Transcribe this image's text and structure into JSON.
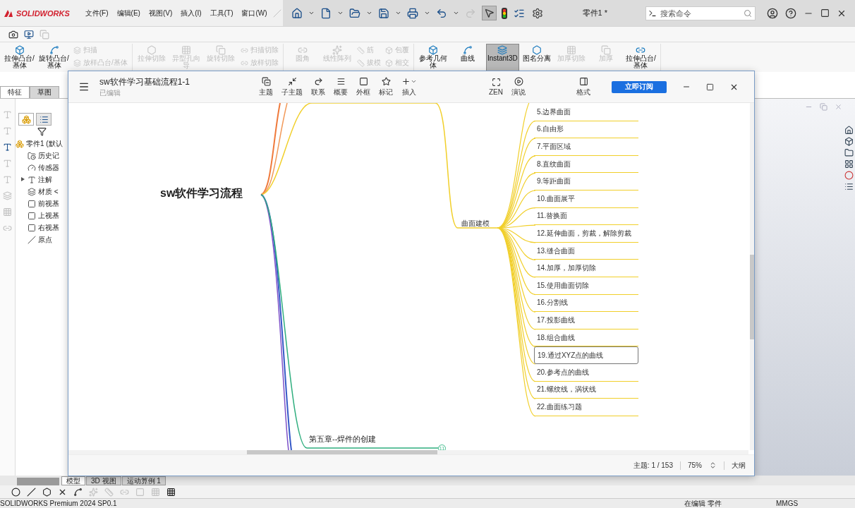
{
  "app": {
    "logo": "SOLIDWORKS",
    "menus": [
      "文件(F)",
      "编辑(E)",
      "视图(V)",
      "插入(I)",
      "工具(T)",
      "窗口(W)"
    ],
    "document_title": "零件1 *",
    "search": {
      "placeholder": "搜索命令"
    }
  },
  "ribbon": [
    {
      "items": [
        {
          "kind": "large",
          "label": "拉伸凸台/基体",
          "disabled": false,
          "on": false
        },
        {
          "kind": "large",
          "label": "旋转凸台/基体",
          "disabled": false,
          "on": false
        },
        {
          "kind": "stack",
          "items": [
            {
              "label": "扫描",
              "disabled": true
            },
            {
              "label": "放样凸台/基体",
              "disabled": true
            }
          ]
        }
      ]
    },
    {
      "items": [
        {
          "kind": "large",
          "label": "拉伸切除",
          "disabled": true,
          "on": false
        },
        {
          "kind": "large",
          "label": "异型孔向导",
          "disabled": true,
          "on": false
        },
        {
          "kind": "large",
          "label": "旋转切除",
          "disabled": true,
          "on": false
        },
        {
          "kind": "stack",
          "items": [
            {
              "label": "扫描切除",
              "disabled": true
            },
            {
              "label": "放样切除",
              "disabled": true
            }
          ]
        }
      ]
    },
    {
      "items": [
        {
          "kind": "large",
          "label": "圆角",
          "disabled": true,
          "on": false
        },
        {
          "kind": "large",
          "label": "线性阵列",
          "disabled": true,
          "on": false
        },
        {
          "kind": "stack",
          "items": [
            {
              "label": "筋",
              "disabled": true
            },
            {
              "label": "拔模",
              "disabled": true
            }
          ]
        },
        {
          "kind": "stack",
          "items": [
            {
              "label": "包覆",
              "disabled": true
            },
            {
              "label": "相交",
              "disabled": true
            }
          ]
        }
      ]
    },
    {
      "items": [
        {
          "kind": "large",
          "label": "参考几何体",
          "disabled": false,
          "on": false
        },
        {
          "kind": "large",
          "label": "曲线",
          "disabled": false,
          "on": false
        },
        {
          "kind": "large",
          "label": "Instant3D",
          "disabled": false,
          "on": true
        },
        {
          "kind": "large",
          "label": "图名分离",
          "disabled": false,
          "on": false
        },
        {
          "kind": "large",
          "label": "加厚切除",
          "disabled": true,
          "on": false
        },
        {
          "kind": "large",
          "label": "加厚",
          "disabled": true,
          "on": false
        },
        {
          "kind": "large",
          "label": "拉伸凸台/基体",
          "disabled": false,
          "on": false
        }
      ]
    }
  ],
  "command_tabs": [
    {
      "label": "特征",
      "selected": true
    },
    {
      "label": "草图",
      "selected": false
    }
  ],
  "feature_tree": [
    {
      "label": "零件1 (默认",
      "collapsed": false,
      "children": [
        {
          "label": "历史记",
          "collapsed": false
        },
        {
          "label": "传感器",
          "collapsed": false
        },
        {
          "label": "注解",
          "collapsed": true
        },
        {
          "label": "材质 <",
          "collapsed": false
        },
        {
          "label": "前视基",
          "collapsed": false
        },
        {
          "label": "上视基",
          "collapsed": false
        },
        {
          "label": "右视基",
          "collapsed": false
        },
        {
          "label": "原点",
          "collapsed": false
        }
      ]
    }
  ],
  "mindmap": {
    "title": "sw软件学习基础流程1-1",
    "status": "已编辑",
    "toolbar": [
      "主题",
      "子主题",
      "联系",
      "概要",
      "外框",
      "标记",
      "插入",
      "ZEN",
      "演说",
      "格式"
    ],
    "subscribe": "立即订阅",
    "central": "sw软件学习流程",
    "branch": "曲面建模",
    "topics": [
      {
        "label": "5.边界曲面",
        "selected": false
      },
      {
        "label": "6.自由形",
        "selected": false
      },
      {
        "label": "7.平面区域",
        "selected": false
      },
      {
        "label": "8.直纹曲面",
        "selected": false
      },
      {
        "label": "9.等距曲面",
        "selected": false
      },
      {
        "label": "10.曲面展平",
        "selected": false
      },
      {
        "label": "11.替换面",
        "selected": false
      },
      {
        "label": "12.延伸曲面，剪裁，解除剪裁",
        "selected": false
      },
      {
        "label": "13.缝合曲面",
        "selected": false
      },
      {
        "label": "14.加厚，加厚切除",
        "selected": false
      },
      {
        "label": "15.使用曲面切除",
        "selected": false
      },
      {
        "label": "16.分割线",
        "selected": false
      },
      {
        "label": "17.投影曲线",
        "selected": false
      },
      {
        "label": "18.组合曲线",
        "selected": false
      },
      {
        "label": "19.通过XYZ点的曲线",
        "selected": true
      },
      {
        "label": "20.参考点的曲线",
        "selected": false
      },
      {
        "label": "21.螺纹线，涡状线",
        "selected": false
      },
      {
        "label": "22.曲面练习题",
        "selected": false
      }
    ],
    "chapter": {
      "label": "第五章--焊件的创建",
      "collapsed_count": "11"
    },
    "footer": {
      "topic_count": "主题: 1 / 153",
      "zoom": "75%",
      "outline": "大纲"
    }
  },
  "model_tabs": [
    {
      "label": "模型",
      "selected": true
    },
    {
      "label": "3D 视图",
      "selected": false
    },
    {
      "label": "运动算例 1",
      "selected": false
    }
  ],
  "status_bar": {
    "product": "SOLIDWORKS Premium 2024 SP0.1",
    "mode": "在编辑 零件",
    "units": "MMGS"
  }
}
